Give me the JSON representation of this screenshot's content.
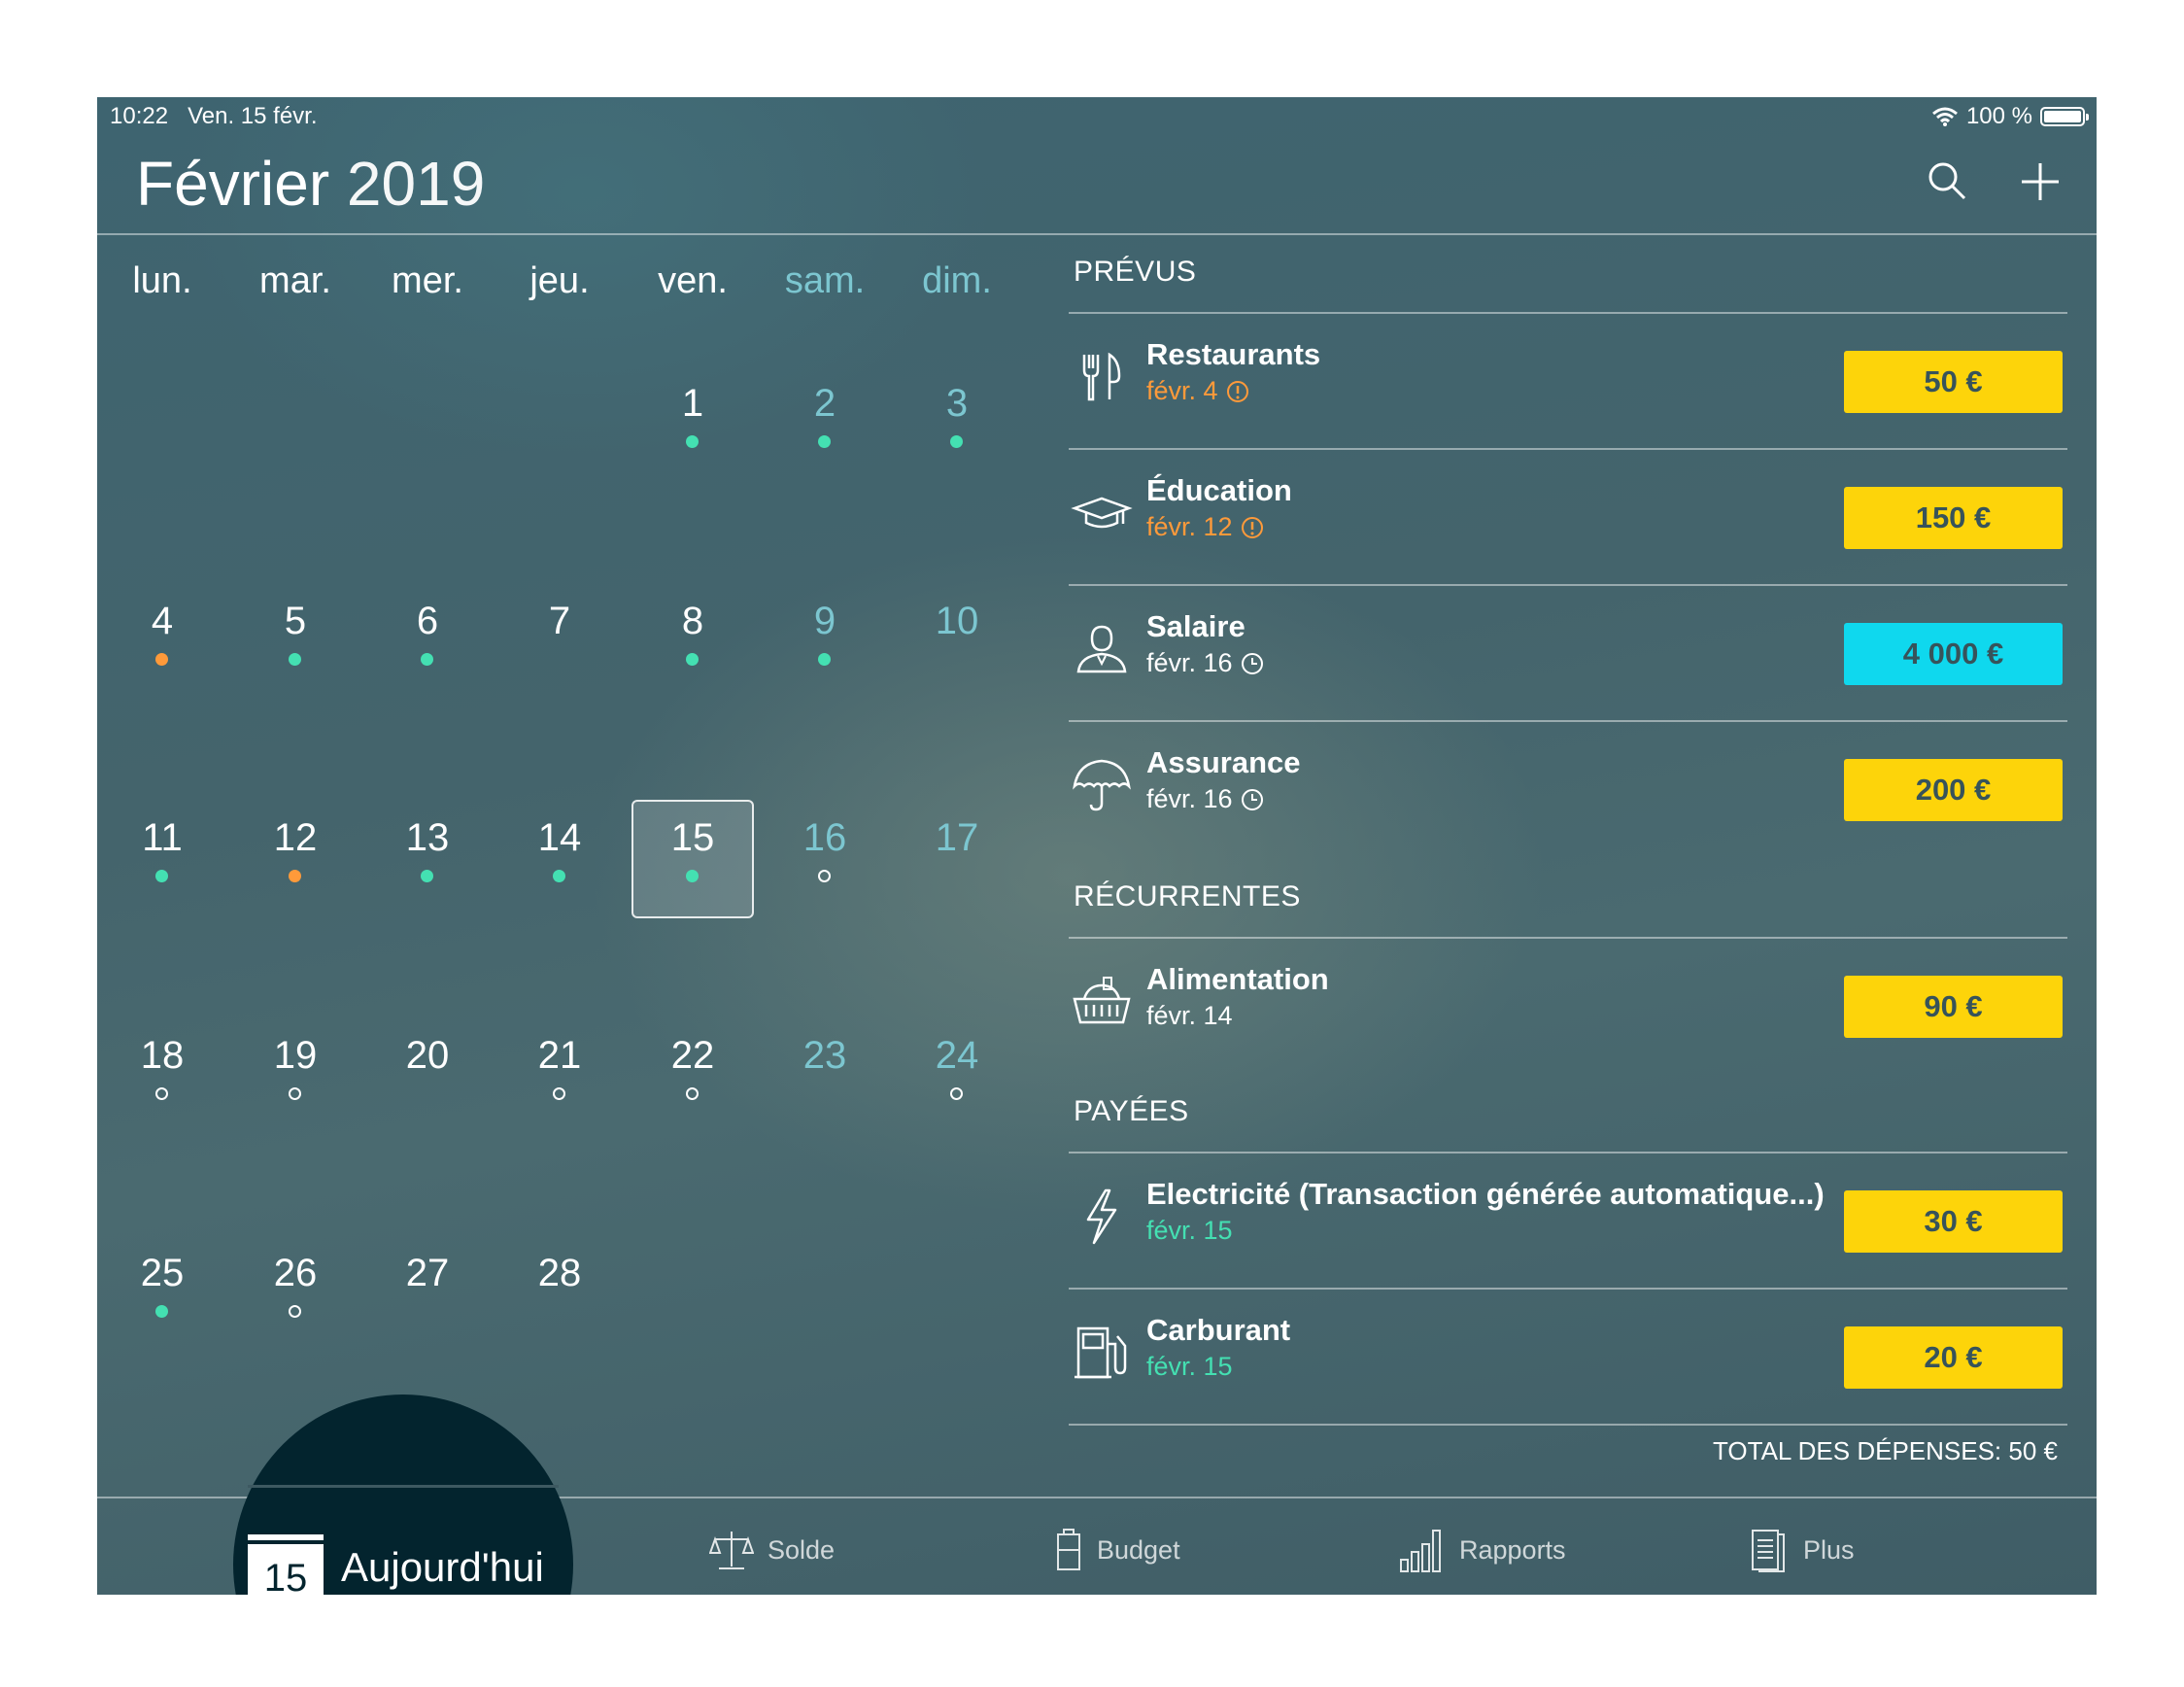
{
  "status_bar": {
    "time": "10:22",
    "date": "Ven. 15 févr.",
    "battery": "100 %"
  },
  "header": {
    "month": "Février",
    "year": "2019",
    "search_icon": "search-icon",
    "add_icon": "plus-icon"
  },
  "calendar": {
    "weekdays": [
      "lun.",
      "mar.",
      "mer.",
      "jeu.",
      "ven.",
      "sam.",
      "dim."
    ],
    "selected_day": "15",
    "days": [
      {
        "n": "1",
        "col": 4,
        "row": 0,
        "dot": "green"
      },
      {
        "n": "2",
        "col": 5,
        "row": 0,
        "dot": "green"
      },
      {
        "n": "3",
        "col": 6,
        "row": 0,
        "dot": "green"
      },
      {
        "n": "4",
        "col": 0,
        "row": 1,
        "dot": "orange"
      },
      {
        "n": "5",
        "col": 1,
        "row": 1,
        "dot": "green"
      },
      {
        "n": "6",
        "col": 2,
        "row": 1,
        "dot": "green"
      },
      {
        "n": "7",
        "col": 3,
        "row": 1,
        "dot": ""
      },
      {
        "n": "8",
        "col": 4,
        "row": 1,
        "dot": "green"
      },
      {
        "n": "9",
        "col": 5,
        "row": 1,
        "dot": "green"
      },
      {
        "n": "10",
        "col": 6,
        "row": 1,
        "dot": ""
      },
      {
        "n": "11",
        "col": 0,
        "row": 2,
        "dot": "green"
      },
      {
        "n": "12",
        "col": 1,
        "row": 2,
        "dot": "orange"
      },
      {
        "n": "13",
        "col": 2,
        "row": 2,
        "dot": "green"
      },
      {
        "n": "14",
        "col": 3,
        "row": 2,
        "dot": "green"
      },
      {
        "n": "15",
        "col": 4,
        "row": 2,
        "dot": "green"
      },
      {
        "n": "16",
        "col": 5,
        "row": 2,
        "dot": "hollow"
      },
      {
        "n": "17",
        "col": 6,
        "row": 2,
        "dot": ""
      },
      {
        "n": "18",
        "col": 0,
        "row": 3,
        "dot": "hollow"
      },
      {
        "n": "19",
        "col": 1,
        "row": 3,
        "dot": "hollow"
      },
      {
        "n": "20",
        "col": 2,
        "row": 3,
        "dot": ""
      },
      {
        "n": "21",
        "col": 3,
        "row": 3,
        "dot": "hollow"
      },
      {
        "n": "22",
        "col": 4,
        "row": 3,
        "dot": "hollow"
      },
      {
        "n": "23",
        "col": 5,
        "row": 3,
        "dot": ""
      },
      {
        "n": "24",
        "col": 6,
        "row": 3,
        "dot": "hollow"
      },
      {
        "n": "25",
        "col": 0,
        "row": 4,
        "dot": "green"
      },
      {
        "n": "26",
        "col": 1,
        "row": 4,
        "dot": "hollow"
      },
      {
        "n": "27",
        "col": 2,
        "row": 4,
        "dot": ""
      },
      {
        "n": "28",
        "col": 3,
        "row": 4,
        "dot": ""
      }
    ]
  },
  "sections": {
    "planned": "PRÉVUS",
    "recurring": "RÉCURRENTES",
    "paid": "PAYÉES"
  },
  "items": [
    {
      "name": "Restaurants",
      "date": "févr. 4",
      "status_icon": "alert-icon",
      "date_color": "#ff9a3a",
      "amount": "50 €",
      "amount_color": "#fdd40a",
      "icon": "cutlery-icon"
    },
    {
      "name": "Éducation",
      "date": "févr. 12",
      "status_icon": "alert-icon",
      "date_color": "#ff9a3a",
      "amount": "150 €",
      "amount_color": "#fdd40a",
      "icon": "graduation-cap-icon"
    },
    {
      "name": "Salaire",
      "date": "févr. 16",
      "status_icon": "clock-icon",
      "date_color": "#ffffff",
      "amount": "4 000 €",
      "amount_color": "#0fd8ee",
      "icon": "person-icon"
    },
    {
      "name": "Assurance",
      "date": "févr. 16",
      "status_icon": "clock-icon",
      "date_color": "#ffffff",
      "amount": "200 €",
      "amount_color": "#fdd40a",
      "icon": "umbrella-icon"
    },
    {
      "name": "Alimentation",
      "date": "févr. 14",
      "status_icon": "",
      "date_color": "#ffffff",
      "amount": "90 €",
      "amount_color": "#fdd40a",
      "icon": "basket-icon"
    },
    {
      "name": "Electricité (Transaction générée automatique...)",
      "date": "févr. 15",
      "status_icon": "",
      "date_color": "#44e0b2",
      "amount": "30 €",
      "amount_color": "#fdd40a",
      "icon": "lightning-icon"
    },
    {
      "name": "Carburant",
      "date": "févr. 15",
      "status_icon": "",
      "date_color": "#44e0b2",
      "amount": "20 €",
      "amount_color": "#fdd40a",
      "icon": "fuel-pump-icon"
    }
  ],
  "total": "TOTAL DES DÉPENSES: 50 €",
  "tabbar": {
    "today": {
      "label": "Aujourd'hui",
      "day": "15"
    },
    "balance": "Solde",
    "budget": "Budget",
    "reports": "Rapports",
    "more": "Plus"
  },
  "colors": {
    "accent_green": "#44e0b2",
    "accent_orange": "#ff9a3a",
    "yellow": "#fdd40a",
    "cyan": "#0fd8ee",
    "weekend": "#7cc6d0"
  }
}
